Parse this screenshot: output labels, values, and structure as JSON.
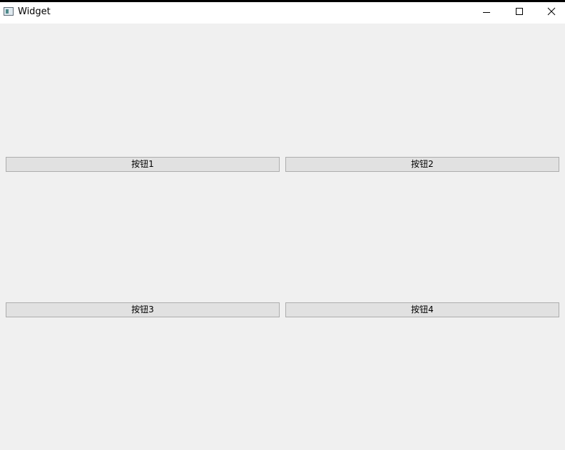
{
  "window": {
    "title": "Widget",
    "app_icon": "window-app-icon",
    "controls": {
      "minimize_icon": "minimize-icon",
      "maximize_icon": "maximize-icon",
      "close_icon": "close-icon"
    }
  },
  "buttons": [
    {
      "label": "按钮1"
    },
    {
      "label": "按钮2"
    },
    {
      "label": "按钮3"
    },
    {
      "label": "按钮4"
    }
  ],
  "colors": {
    "background": "#f0f0f0",
    "button_face": "#e1e1e1",
    "button_border": "#adadad",
    "titlebar": "#ffffff"
  }
}
